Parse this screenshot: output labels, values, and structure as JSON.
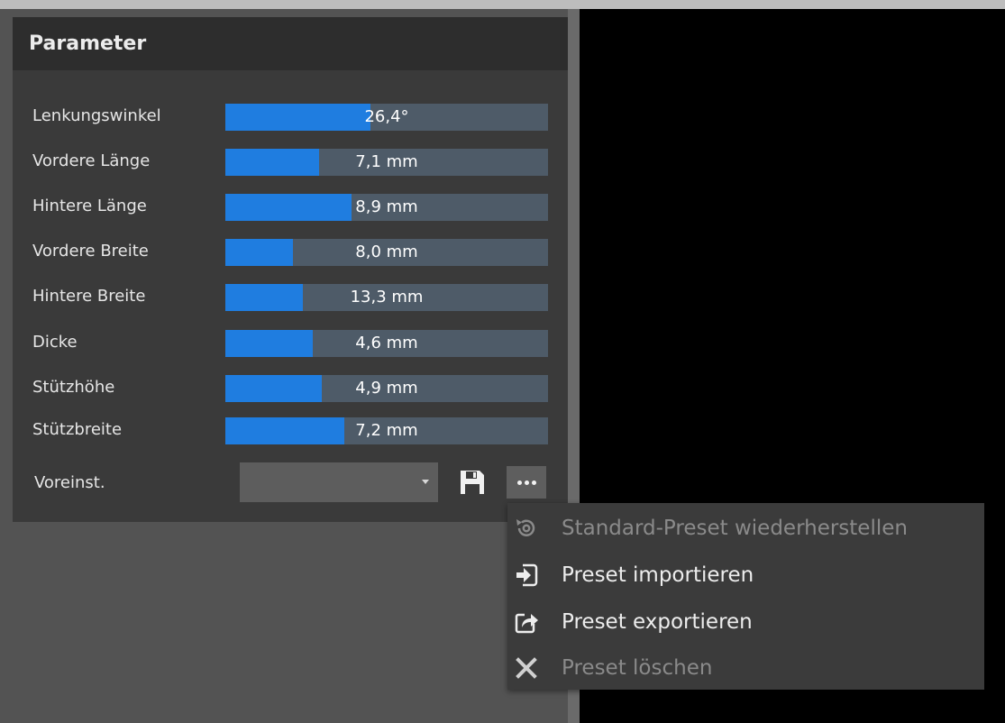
{
  "panel": {
    "title": "Parameter"
  },
  "params": [
    {
      "label": "Lenkungswinkel",
      "value": "26,4°",
      "fill": 0.45
    },
    {
      "label": "Vordere Länge",
      "value": "7,1 mm",
      "fill": 0.29
    },
    {
      "label": "Hintere Länge",
      "value": "8,9 mm",
      "fill": 0.39
    },
    {
      "label": "Vordere Breite",
      "value": "8,0 mm",
      "fill": 0.21
    },
    {
      "label": "Hintere Breite",
      "value": "13,3 mm",
      "fill": 0.24
    },
    {
      "label": "Dicke",
      "value": "4,6 mm",
      "fill": 0.27
    },
    {
      "label": "Stützhöhe",
      "value": "4,9 mm",
      "fill": 0.3
    },
    {
      "label": "Stützbreite",
      "value": "7,2 mm",
      "fill": 0.37
    }
  ],
  "preset": {
    "label": "Voreinst.",
    "selected": "",
    "save_icon": "floppy-disk-icon",
    "more_icon": "ellipsis-icon"
  },
  "menu": {
    "items": [
      {
        "label": "Standard-Preset wiederherstellen",
        "icon": "restore-icon",
        "enabled": false
      },
      {
        "label": "Preset importieren",
        "icon": "import-icon",
        "enabled": true
      },
      {
        "label": "Preset exportieren",
        "icon": "export-icon",
        "enabled": true
      },
      {
        "label": "Preset löschen",
        "icon": "delete-x-icon",
        "enabled": false
      }
    ]
  },
  "colors": {
    "accent": "#1f7de0",
    "track": "#4e5b68",
    "panel": "#3a3a3a",
    "viewport": "#000000"
  }
}
